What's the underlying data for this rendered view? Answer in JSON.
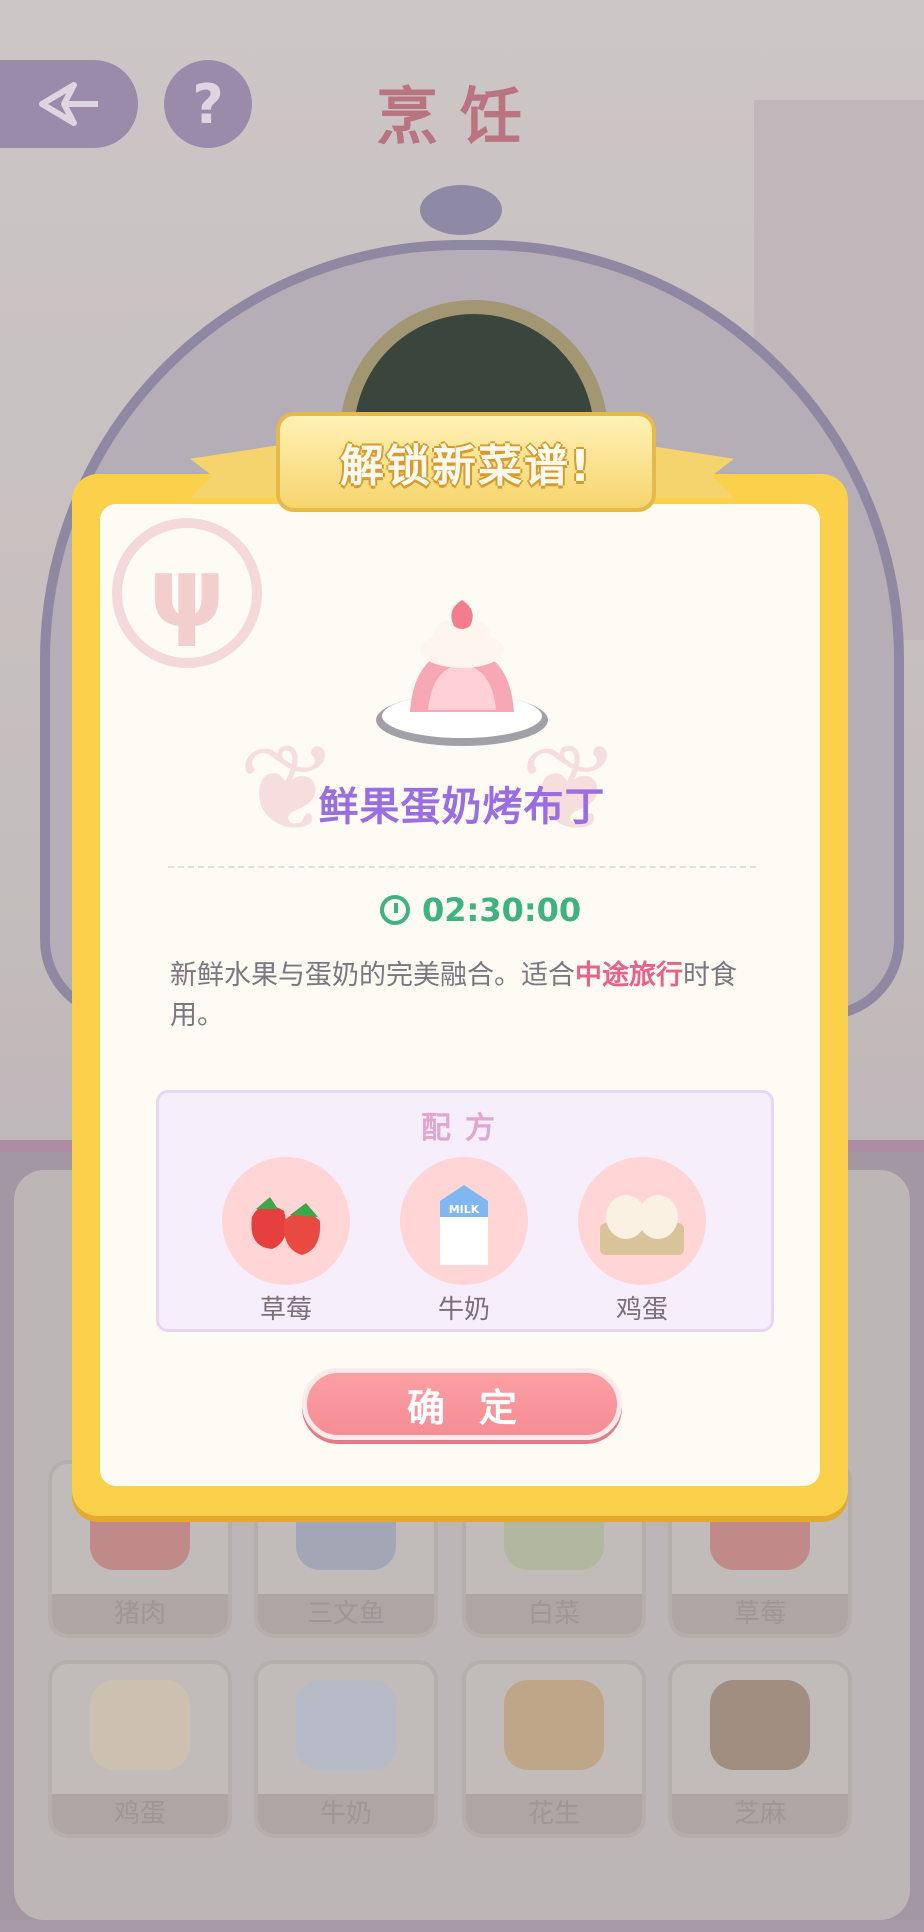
{
  "screen": {
    "title": "烹饪"
  },
  "grid": {
    "row1": [
      "猪肉",
      "三文鱼",
      "白菜",
      "草莓"
    ],
    "row2": [
      "鸡蛋",
      "牛奶",
      "花生",
      "芝麻"
    ]
  },
  "modal": {
    "banner": "解锁新菜谱!",
    "dish_name": "鲜果蛋奶烤布丁",
    "timer": "02:30:00",
    "description_prefix": "新鲜水果与蛋奶的完美融合。适合",
    "description_highlight": "中途旅行",
    "description_suffix": "时食用。",
    "recipe_title": "配方",
    "ingredients": [
      {
        "label": "草莓",
        "icon": "strawberry-icon"
      },
      {
        "label": "牛奶",
        "icon": "milk-carton-icon"
      },
      {
        "label": "鸡蛋",
        "icon": "eggs-icon"
      }
    ],
    "confirm_label": "确定"
  },
  "colors": {
    "modal_border": "#fbd14b",
    "dish_name": "#9a6de0",
    "timer": "#3fb37f",
    "highlight": "#e96285",
    "confirm_button": "#f58d94"
  }
}
